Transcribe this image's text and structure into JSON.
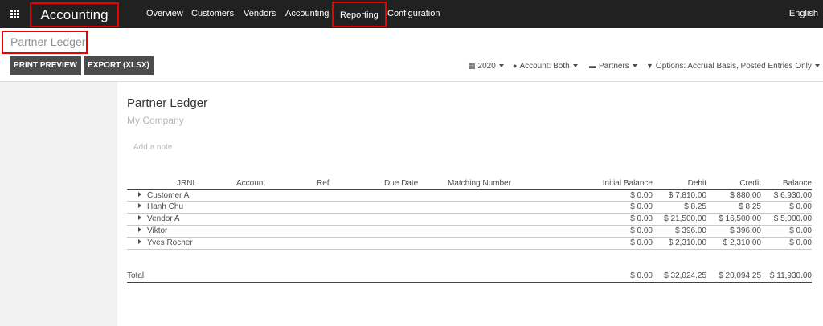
{
  "navbar": {
    "app_name": "Accounting",
    "menu": [
      "Overview",
      "Customers",
      "Vendors",
      "Accounting",
      "Reporting",
      "Configuration"
    ],
    "language": "English"
  },
  "breadcrumb": "Partner Ledger",
  "buttons": {
    "print_preview": "PRINT PREVIEW",
    "export": "EXPORT (XLSX)"
  },
  "filters": {
    "date": "2020",
    "account": "Account: Both",
    "partners": "Partners",
    "options": "Options: Accrual Basis, Posted Entries Only"
  },
  "report": {
    "title": "Partner Ledger",
    "company": "My Company",
    "note_placeholder": "Add a note",
    "columns": [
      "JRNL",
      "Account",
      "Ref",
      "Due Date",
      "Matching Number",
      "Initial Balance",
      "Debit",
      "Credit",
      "Balance"
    ],
    "rows": [
      {
        "partner": "Customer A",
        "initial": "$ 0.00",
        "debit": "$ 7,810.00",
        "credit": "$ 880.00",
        "balance": "$ 6,930.00"
      },
      {
        "partner": "Hanh Chu",
        "initial": "$ 0.00",
        "debit": "$ 8.25",
        "credit": "$ 8.25",
        "balance": "$ 0.00"
      },
      {
        "partner": "Vendor A",
        "initial": "$ 0.00",
        "debit": "$ 21,500.00",
        "credit": "$ 16,500.00",
        "balance": "$ 5,000.00"
      },
      {
        "partner": "Viktor",
        "initial": "$ 0.00",
        "debit": "$ 396.00",
        "credit": "$ 396.00",
        "balance": "$ 0.00"
      },
      {
        "partner": "Yves Rocher",
        "initial": "$ 0.00",
        "debit": "$ 2,310.00",
        "credit": "$ 2,310.00",
        "balance": "$ 0.00"
      }
    ],
    "total": {
      "label": "Total",
      "initial": "$ 0.00",
      "debit": "$ 32,024.25",
      "credit": "$ 20,094.25",
      "balance": "$ 11,930.00"
    }
  },
  "colors": {
    "navbar": "#212121",
    "highlight": "#ee0000",
    "button": "#4c4c4c",
    "sidebar": "#f2f2f2"
  }
}
